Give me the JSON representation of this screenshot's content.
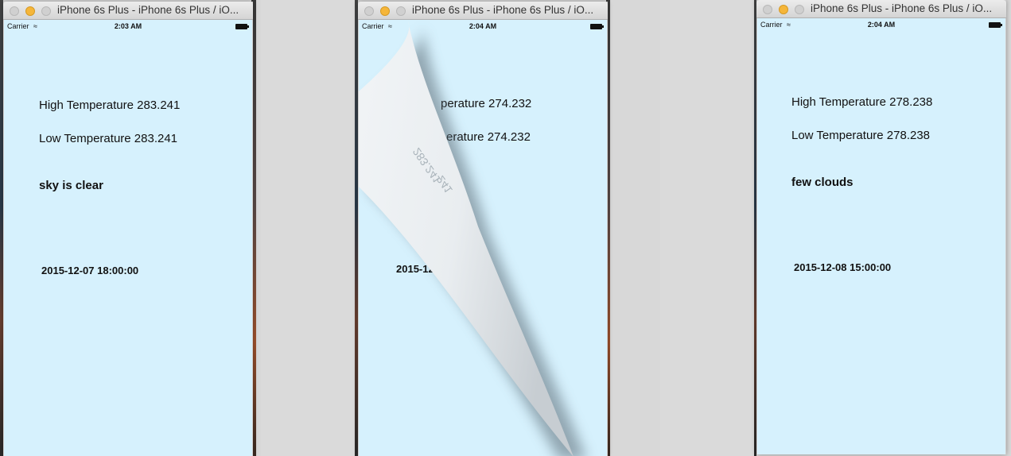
{
  "windows": [
    {
      "title": "iPhone 6s Plus - iPhone 6s Plus / iO...",
      "status": {
        "carrier": "Carrier",
        "time": "2:03 AM"
      },
      "weather": {
        "high": "High Temperature 283.241",
        "low": "Low Temperature 283.241",
        "description": "sky is clear",
        "date": "2015-12-07 18:00:00"
      }
    },
    {
      "title": "iPhone 6s Plus - iPhone 6s Plus / iO...",
      "status": {
        "carrier": "Carrier",
        "time": "2:04 AM"
      },
      "weather": {
        "high_partial": "perature 274.232",
        "low_partial": "erature 274.232",
        "date_partial": "2015-12",
        "backside_text_1": "283.241",
        "backside_text_2": "241"
      }
    },
    {
      "title": "iPhone 6s Plus - iPhone 6s Plus / iO...",
      "status": {
        "carrier": "Carrier",
        "time": "2:04 AM"
      },
      "weather": {
        "high": "High Temperature 278.238",
        "low": "Low Temperature 278.238",
        "description": "few clouds",
        "date": "2015-12-08 15:00:00"
      }
    }
  ],
  "colors": {
    "screen_bg": "#d6f1fd",
    "traffic_minimize": "#f5b63a"
  }
}
